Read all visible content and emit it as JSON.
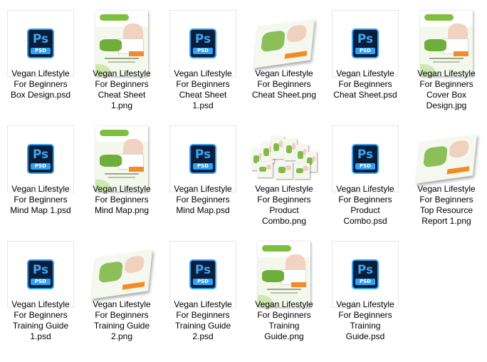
{
  "files": [
    {
      "label": "Vegan Lifestyle\nFor Beginners\nBox Design.psd",
      "kind": "psd"
    },
    {
      "label": "Vegan Lifestyle\nFor Beginners\nCheat Sheet\n1.png",
      "kind": "cover"
    },
    {
      "label": "Vegan Lifestyle\nFor Beginners\nCheat Sheet\n1.psd",
      "kind": "psd"
    },
    {
      "label": "Vegan Lifestyle\nFor Beginners\nCheat Sheet.png",
      "kind": "book"
    },
    {
      "label": "Vegan Lifestyle\nFor Beginners\nCheat Sheet.psd",
      "kind": "psd"
    },
    {
      "label": "Vegan Lifestyle\nFor Beginners\nCover Box\nDesign.jpg",
      "kind": "cover"
    },
    {
      "label": "Vegan Lifestyle\nFor Beginners\nMind Map 1.psd",
      "kind": "psd"
    },
    {
      "label": "Vegan Lifestyle\nFor Beginners\nMind Map.png",
      "kind": "cover"
    },
    {
      "label": "Vegan Lifestyle\nFor Beginners\nMind Map.psd",
      "kind": "psd"
    },
    {
      "label": "Vegan Lifestyle\nFor Beginners\nProduct\nCombo.png",
      "kind": "combo"
    },
    {
      "label": "Vegan Lifestyle\nFor Beginners\nProduct\nCombo.psd",
      "kind": "psd"
    },
    {
      "label": "Vegan Lifestyle\nFor Beginners\nTop Resource\nReport 1.png",
      "kind": "book"
    },
    {
      "label": "Vegan Lifestyle\nFor Beginners\nTraining Guide\n1.psd",
      "kind": "psd"
    },
    {
      "label": "Vegan Lifestyle\nFor Beginners\nTraining Guide\n2.png",
      "kind": "book"
    },
    {
      "label": "Vegan Lifestyle\nFor Beginners\nTraining Guide\n2.psd",
      "kind": "psd"
    },
    {
      "label": "Vegan Lifestyle\nFor Beginners\nTraining\nGuide.png",
      "kind": "cover"
    },
    {
      "label": "Vegan Lifestyle\nFor Beginners\nTraining\nGuide.psd",
      "kind": "psd"
    }
  ],
  "psd_icon": {
    "letters": "Ps",
    "band": "PSD"
  },
  "colors": {
    "ps_bg": "#0b1d38",
    "ps_accent": "#2fa3f7",
    "cover_green": "#7fbf3f",
    "cover_orange": "#f28c2a"
  }
}
